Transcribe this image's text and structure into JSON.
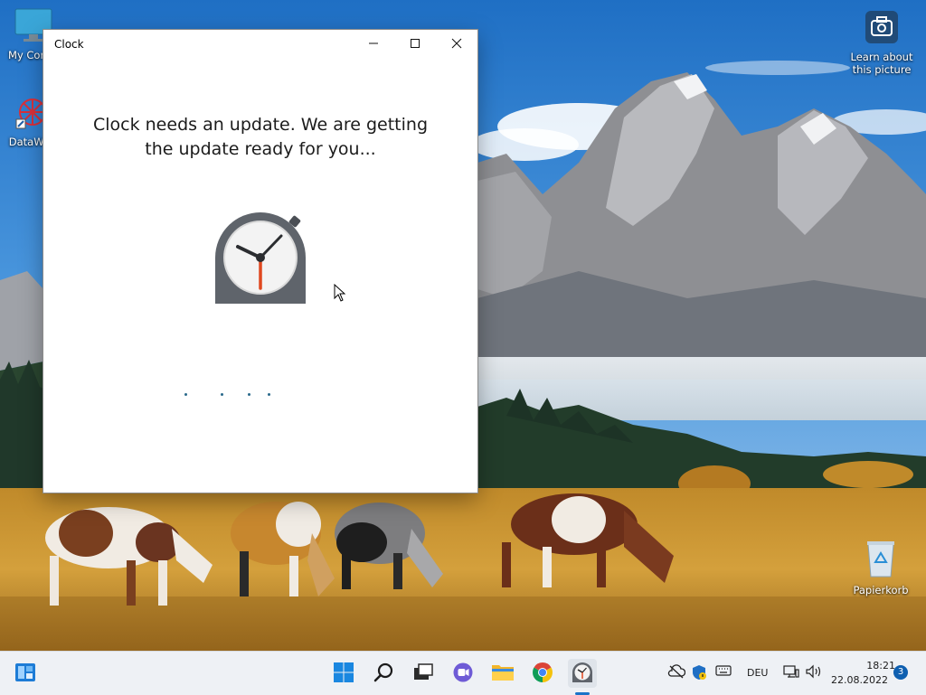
{
  "desktop": {
    "icons": [
      {
        "label": "My Comp"
      },
      {
        "label": "DataWag"
      },
      {
        "label": "Papierkorb"
      }
    ],
    "learn_about_picture": {
      "line1": "Learn about",
      "line2": "this picture"
    }
  },
  "window": {
    "title": "Clock",
    "controls": {
      "minimize": "minimize",
      "maximize": "maximize",
      "close": "close"
    },
    "message_line1": "Clock needs an update. We are getting",
    "message_line2": "the update ready for you...",
    "accent_color": "#2a6a8c"
  },
  "taskbar": {
    "pinned": [
      "widgets-icon",
      "start-icon",
      "search-icon",
      "task-view-icon",
      "chat-icon",
      "file-explorer-icon",
      "chrome-icon",
      "clock-app-icon"
    ],
    "tray": {
      "language": "DEU",
      "time": "18:21",
      "date": "22.08.2022",
      "notification_count": "3"
    }
  }
}
